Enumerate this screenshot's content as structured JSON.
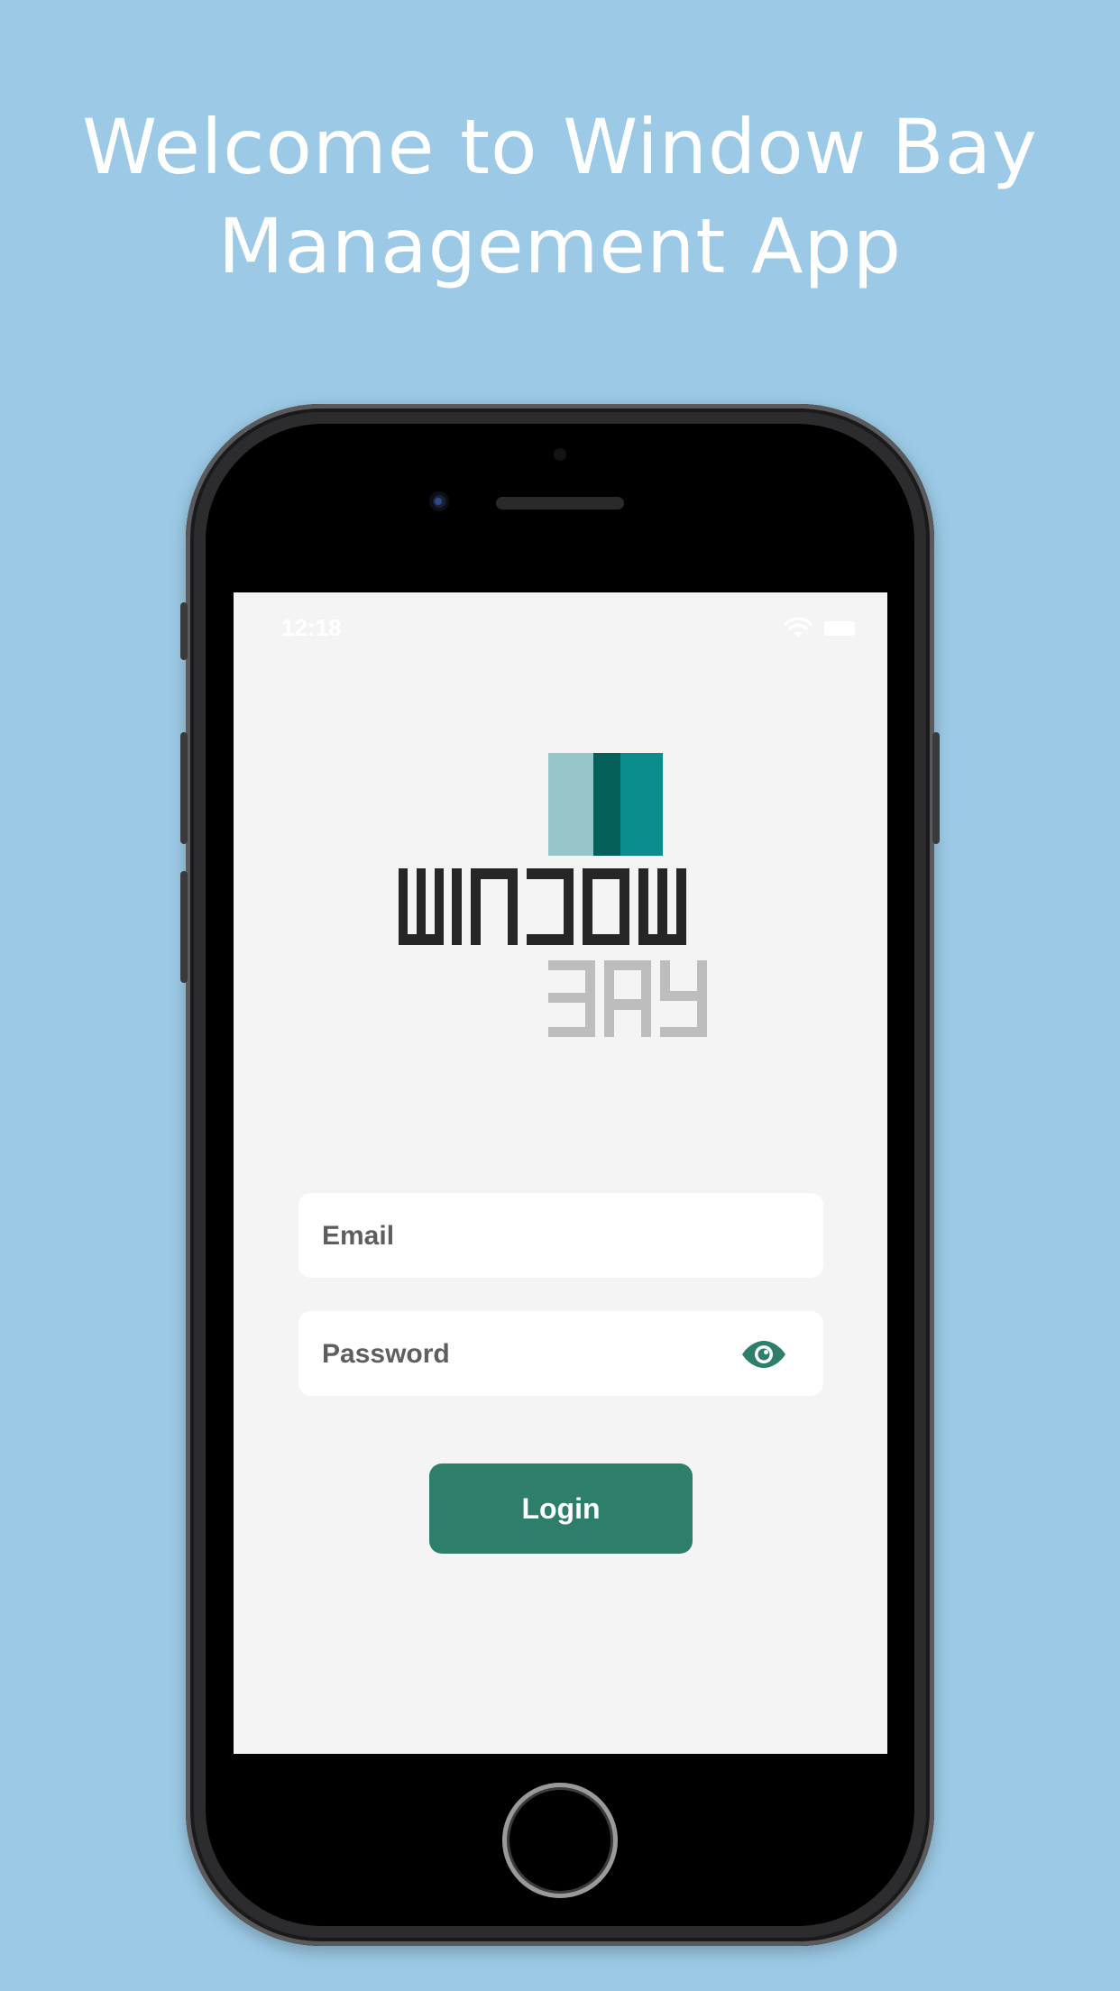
{
  "headline": {
    "line1": "Welcome to Window Bay",
    "line2": "Management App"
  },
  "status_bar": {
    "time": "12:18",
    "wifi_icon": "wifi-icon",
    "battery_icon": "battery-icon"
  },
  "logo": {
    "word1": "WINDOW",
    "word2": "BAY",
    "colors": [
      "#97c6c8",
      "#05605c",
      "#0c8c8c",
      "#262626",
      "#bdbdbd"
    ]
  },
  "login_form": {
    "email_placeholder": "Email",
    "email_value": "",
    "password_placeholder": "Password",
    "password_value": "",
    "password_toggle_icon": "eye-icon",
    "login_label": "Login"
  },
  "colors": {
    "background": "#9ccae6",
    "accent": "#2e7e6c",
    "screen_background": "#f4f4f4"
  }
}
